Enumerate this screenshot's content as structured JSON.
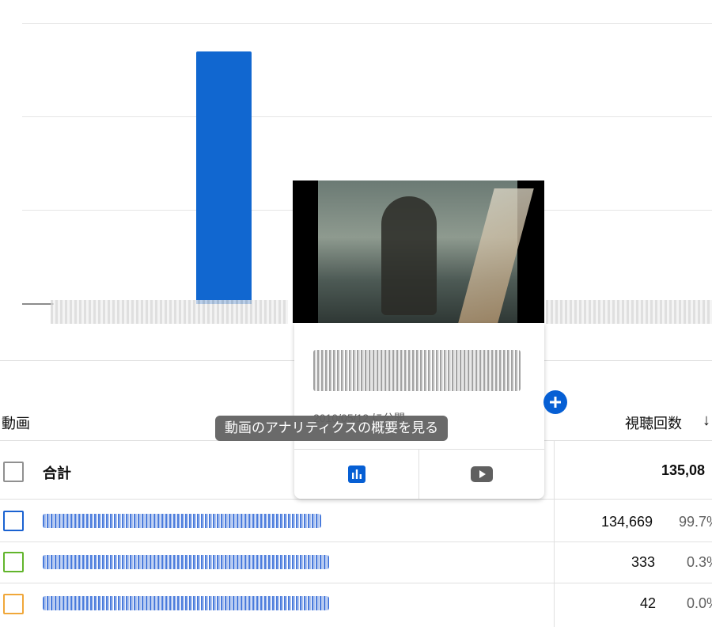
{
  "colors": {
    "accent_blue": "#065fd4",
    "bar_blue": "#1167d0",
    "checkbox_blue": "#1a62d1",
    "checkbox_green": "#62b52c",
    "checkbox_orange": "#f0a73a",
    "tooltip_bg": "#616161"
  },
  "chart_data": {
    "type": "bar",
    "title": "",
    "xlabel": "",
    "ylabel": "",
    "categories": [
      "",
      ""
    ],
    "series": [
      {
        "values": [
          134669,
          333
        ]
      }
    ],
    "grid": true
  },
  "table": {
    "column_video": "動画",
    "column_views": "視聴回数",
    "sort_icon": "arrow-down-icon",
    "total_label": "合計",
    "total_views": "135,08",
    "rows": [
      {
        "title": " ",
        "views": "134,669",
        "percent": "99.7",
        "checkbox_color": "#1a62d1"
      },
      {
        "title": " ",
        "views": "333",
        "percent": "0.3",
        "checkbox_color": "#62b52c"
      },
      {
        "title": " ",
        "views": "42",
        "percent": "0.0",
        "checkbox_color": "#f0a73a"
      }
    ]
  },
  "hover_card": {
    "date_text": "2010/05/12 に公開",
    "analytics_icon": "bar-chart-icon",
    "youtube_icon": "youtube-play-icon"
  },
  "tooltip": {
    "text": "動画のアナリティクスの概要を見る"
  },
  "add_icon": "plus-icon"
}
